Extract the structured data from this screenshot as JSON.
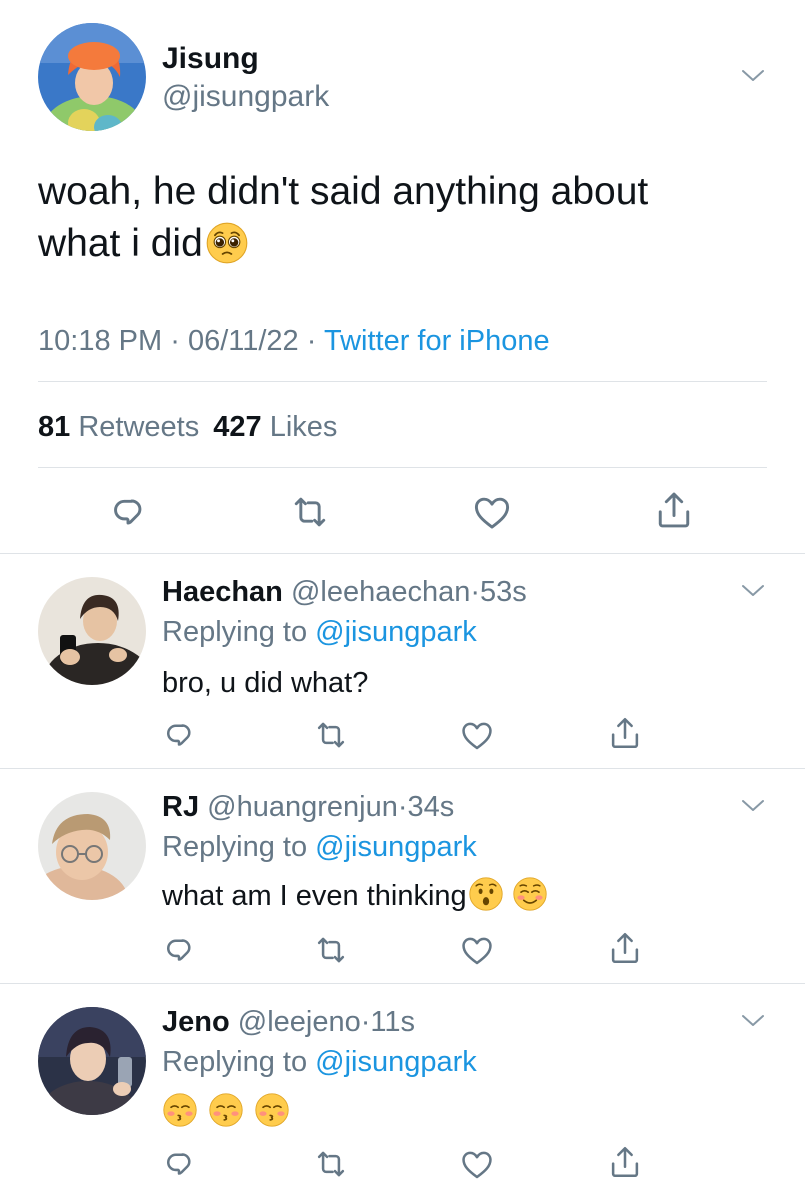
{
  "main_tweet": {
    "display_name": "Jisung",
    "handle": "@jisungpark",
    "text_line1": "woah, he didn't said anything about",
    "text_line2": "what i did",
    "time": "10:18 PM",
    "date": "06/11/22",
    "dot": "·",
    "source": "Twitter for iPhone",
    "retweets_count": "81",
    "retweets_label": "Retweets",
    "likes_count": "427",
    "likes_label": "Likes",
    "emoji_icon": "pleading-face-emoji"
  },
  "replies": [
    {
      "display_name": "Haechan",
      "handle": "@leehaechan",
      "dot": "·",
      "age": "53s",
      "replying_label": "Replying to",
      "replying_handle": "@jisungpark",
      "text": "bro, u did what?"
    },
    {
      "display_name": "RJ",
      "handle": "@huangrenjun",
      "dot": "·",
      "age": "34s",
      "replying_label": "Replying to",
      "replying_handle": "@jisungpark",
      "text": "what am I even thinking",
      "emoji_icons": [
        "hushed-face-emoji",
        "smiling-face-emoji"
      ]
    },
    {
      "display_name": "Jeno",
      "handle": "@leejeno",
      "dot": "·",
      "age": "11s",
      "replying_label": "Replying to",
      "replying_handle": "@jisungpark",
      "emoji_icons": [
        "kissing-face-emoji",
        "kissing-face-emoji",
        "kissing-face-emoji"
      ]
    }
  ],
  "colors": {
    "link": "#1b95e0",
    "secondary_text": "#657786",
    "icon": "#657786",
    "divider": "#dfe3e7"
  },
  "icons": [
    "reply-icon",
    "retweet-icon",
    "like-icon",
    "share-icon",
    "chevron-down-icon"
  ]
}
